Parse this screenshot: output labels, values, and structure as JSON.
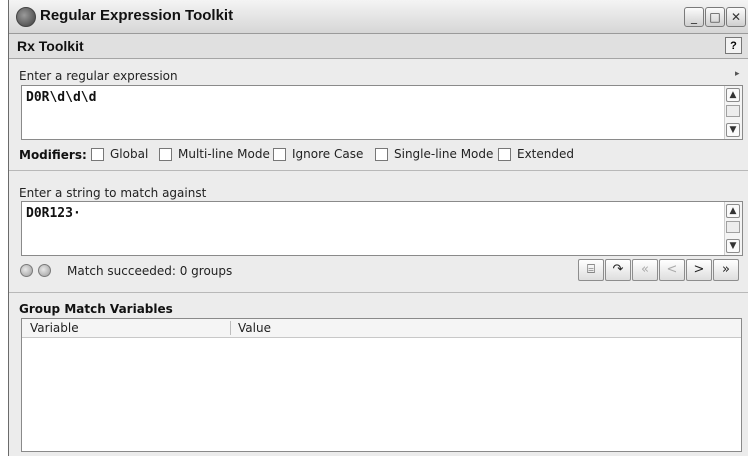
{
  "window": {
    "title": "Regular Expression Toolkit",
    "controls": {
      "minimize": "_",
      "maximize": "□",
      "close": "✕"
    }
  },
  "panel": {
    "title": "Rx Toolkit",
    "help_label": "?"
  },
  "regex": {
    "label": "Enter a regular expression",
    "value": "D0R\\d\\d\\d",
    "menu_arrow": "▸"
  },
  "modifiers": {
    "label": "Modifiers:",
    "options": [
      {
        "label": "Global",
        "checked": false
      },
      {
        "label": "Multi-line Mode",
        "checked": false
      },
      {
        "label": "Ignore Case",
        "checked": false
      },
      {
        "label": "Single-line Mode",
        "checked": false
      },
      {
        "label": "Extended",
        "checked": false
      }
    ]
  },
  "match": {
    "label": "Enter a string to match against",
    "value": "D0R123·",
    "status": "Match succeeded: 0 groups"
  },
  "toolbar": {
    "open_icon": "⌸",
    "replace_icon": "↷",
    "first_label": "«",
    "prev_label": "<",
    "next_label": ">",
    "last_label": "»"
  },
  "groups": {
    "title": "Group Match Variables",
    "columns": [
      "Variable",
      "Value"
    ],
    "rows": []
  },
  "scroll": {
    "up": "▲",
    "down": "▼"
  }
}
